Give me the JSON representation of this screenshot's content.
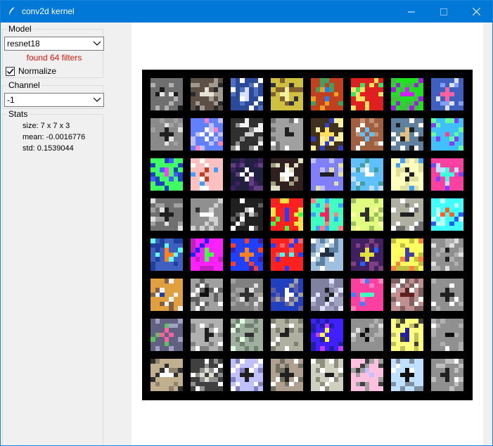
{
  "window": {
    "title": "conv2d kernel"
  },
  "sidebar": {
    "model_group_label": "Model",
    "model_value": "resnet18",
    "found_text": "found 64 filters",
    "normalize_label": "Normalize",
    "normalize_checked": true,
    "channel_group_label": "Channel",
    "channel_value": "-1",
    "stats_group_label": "Stats",
    "stats": {
      "size": "size: 7 x 7 x 3",
      "mean": "mean: -0.0016776",
      "std": "std:  0.1539044"
    }
  },
  "colors": {
    "titlebar": "#0078d7",
    "found_text": "#e0150d",
    "canvas_bg": "#000000"
  },
  "filters": {
    "count": 64,
    "rows": 8,
    "cols": 8,
    "kernel_size": 7,
    "palettes": [
      [
        "#6f6f6f",
        "#e6e6e6",
        "#1a1a1a",
        "#b0b0b0"
      ],
      [
        "#5c5046",
        "#e8e1d6",
        "#2a2a2a",
        "#a09a90"
      ],
      [
        "#2b4a9a",
        "#d8e0ff",
        "#ffffff",
        "#5070c0"
      ],
      [
        "#d0c040",
        "#f0f0a0",
        "#303040",
        "#806030"
      ],
      [
        "#c04020",
        "#2080ff",
        "#f0a020",
        "#40a060"
      ],
      [
        "#e02020",
        "#2060ff",
        "#40e060",
        "#ffe060"
      ],
      [
        "#20e020",
        "#d020ff",
        "#a020e0",
        "#40c040"
      ],
      [
        "#4060c0",
        "#ff60a0",
        "#e0e0e0",
        "#80a0ff"
      ],
      [
        "#8a8a8a",
        "#202020",
        "#e0e0e0",
        "#a0a0a0"
      ],
      [
        "#6080ff",
        "#ffffff",
        "#ff80c0",
        "#c0c0ff"
      ],
      [
        "#303030",
        "#d0d0d0",
        "#909090",
        "#f0f0f0"
      ],
      [
        "#a0a0a0",
        "#202020",
        "#ffffff",
        "#707070"
      ],
      [
        "#403020",
        "#ffe060",
        "#3040c0",
        "#fff0a0"
      ],
      [
        "#a06040",
        "#60c0ff",
        "#ffffff",
        "#c09070"
      ],
      [
        "#6080a0",
        "#e0c080",
        "#202020",
        "#ffffff"
      ],
      [
        "#40c0ff",
        "#ff4080",
        "#8040ff",
        "#60ffa0"
      ],
      [
        "#40ff60",
        "#ff40ff",
        "#4060ff",
        "#2040c0"
      ],
      [
        "#ffc0c0",
        "#c04020",
        "#40a0ff",
        "#ffffff"
      ],
      [
        "#202040",
        "#ffffff",
        "#402060",
        "#604080"
      ],
      [
        "#302020",
        "#ffffff",
        "#a0a080",
        "#e0e0c0"
      ],
      [
        "#8080ff",
        "#202020",
        "#c0c0ff",
        "#e0e0a0"
      ],
      [
        "#60c0ff",
        "#ffffff",
        "#40a0a0",
        "#c0e0ff"
      ],
      [
        "#ffffc0",
        "#202020",
        "#40a0ff",
        "#e0e0a0"
      ],
      [
        "#ff40a0",
        "#40ffe0",
        "#8040ff",
        "#c0e0ff"
      ],
      [
        "#707070",
        "#202020",
        "#e0e0e0",
        "#a0a0a0"
      ],
      [
        "#909090",
        "#ffffff",
        "#303030",
        "#d0d0d0"
      ],
      [
        "#202020",
        "#c0c0c0",
        "#ffffff",
        "#606060"
      ],
      [
        "#ff2020",
        "#2040ff",
        "#40ff40",
        "#ffe040"
      ],
      [
        "#40ffc0",
        "#ff2060",
        "#ff8080",
        "#40a0ff"
      ],
      [
        "#e0ff80",
        "#303030",
        "#ffffa0",
        "#a0c060"
      ],
      [
        "#b0b0a0",
        "#202020",
        "#ffffff",
        "#707070"
      ],
      [
        "#40ffff",
        "#ff6020",
        "#2060ff",
        "#c0ffff"
      ],
      [
        "#4060c0",
        "#ff8020",
        "#60ffff",
        "#2040a0"
      ],
      [
        "#ff20ff",
        "#40ff40",
        "#2020ff",
        "#c020c0"
      ],
      [
        "#2040ff",
        "#ff8020",
        "#4020a0",
        "#ff4020"
      ],
      [
        "#ff2020",
        "#40ffff",
        "#2040ff",
        "#ff6060"
      ],
      [
        "#a0c0e0",
        "#203040",
        "#ffffff",
        "#6080a0"
      ],
      [
        "#402060",
        "#e0e040",
        "#2060ff",
        "#804080"
      ],
      [
        "#ffff60",
        "#4040a0",
        "#ff8040",
        "#c0c040"
      ],
      [
        "#909090",
        "#202020",
        "#e0e0e0",
        "#b0b0b0"
      ],
      [
        "#e0a040",
        "#2040a0",
        "#f0f0f0",
        "#806040"
      ],
      [
        "#a0a0a0",
        "#101010",
        "#ffffff",
        "#606060"
      ],
      [
        "#808080",
        "#303030",
        "#e0e0e0",
        "#a0a0a0"
      ],
      [
        "#2040c0",
        "#ffffff",
        "#a0a0a0",
        "#6060a0"
      ],
      [
        "#8080a0",
        "#202020",
        "#e0e0ff",
        "#a0a0c0"
      ],
      [
        "#ff40a0",
        "#40ffc0",
        "#4080ff",
        "#ff80c0"
      ],
      [
        "#c09090",
        "#602020",
        "#ffffff",
        "#806060"
      ],
      [
        "#909090",
        "#202020",
        "#ffffff",
        "#b0b0b0"
      ],
      [
        "#606080",
        "#ff60a0",
        "#60c060",
        "#a0a0c0"
      ],
      [
        "#b0b0b0",
        "#202020",
        "#ffffff",
        "#808080"
      ],
      [
        "#a0b0a0",
        "#303030",
        "#e0ffe0",
        "#708070"
      ],
      [
        "#b0b0a0",
        "#202020",
        "#ffffff",
        "#808070"
      ],
      [
        "#4020ff",
        "#ffff40",
        "#c040ff",
        "#2020a0"
      ],
      [
        "#909090",
        "#101010",
        "#e0e0e0",
        "#b0b0b0"
      ],
      [
        "#ffff80",
        "#2020a0",
        "#404040",
        "#c0c060"
      ],
      [
        "#909090",
        "#101010",
        "#ffffff",
        "#b0b0b0"
      ],
      [
        "#c0b090",
        "#ffffff",
        "#303030",
        "#908070"
      ],
      [
        "#404040",
        "#e0e0d0",
        "#ffffff",
        "#909090"
      ],
      [
        "#c0c0ff",
        "#202020",
        "#ffffff",
        "#8080c0"
      ],
      [
        "#b0a090",
        "#202020",
        "#ffffff",
        "#707060"
      ],
      [
        "#d0d0c0",
        "#202020",
        "#ffffff",
        "#909080"
      ],
      [
        "#ffc0e0",
        "#c0c0ff",
        "#404040",
        "#a0a0a0"
      ],
      [
        "#c0e0ff",
        "#101010",
        "#ffffff",
        "#8090a0"
      ],
      [
        "#909090",
        "#202020",
        "#ffffff",
        "#c0c0c0"
      ]
    ]
  }
}
